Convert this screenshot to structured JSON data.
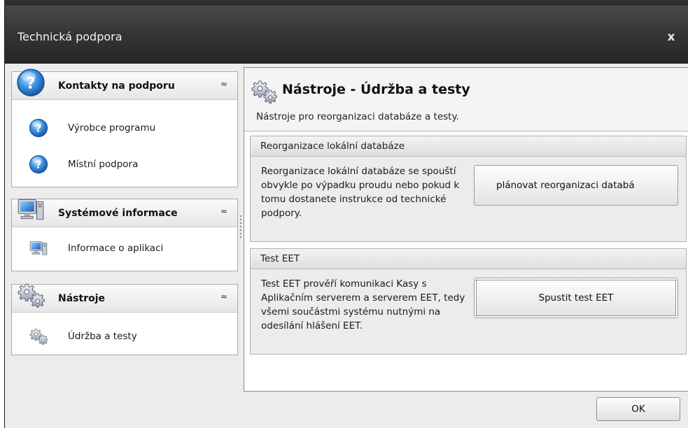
{
  "window": {
    "title": "Technická podpora",
    "close_label": "x"
  },
  "sidebar": {
    "groups": [
      {
        "label": "Kontakty na podporu",
        "icon": "help-icon",
        "items": [
          {
            "label": "Výrobce programu",
            "icon": "help-icon"
          },
          {
            "label": "Místní podpora",
            "icon": "help-icon"
          }
        ]
      },
      {
        "label": "Systémové informace",
        "icon": "computer-icon",
        "items": [
          {
            "label": "Informace o aplikaci",
            "icon": "computer-icon"
          }
        ]
      },
      {
        "label": "Nástroje",
        "icon": "gears-icon",
        "items": [
          {
            "label": "Údržba a testy",
            "icon": "gears-icon"
          }
        ]
      }
    ],
    "collapse_glyph": "≈"
  },
  "main": {
    "title": "Nástroje - Údržba a testy",
    "subtitle": "Nástroje pro reorganizaci databáze a testy.",
    "sections": [
      {
        "header": "Reorganizace lokální databáze",
        "description": "Reorganizace lokální databáze se spouští obvykle po výpadku proudu nebo pokud k tomu dostanete instrukce od technické podpory.",
        "button_label": "plánovat reorganizaci databá"
      },
      {
        "header": "Test EET",
        "description": "Test EET prověří komunikaci Kasy s Aplikačním serverem a serverem EET, tedy všemi součástmi systému nutnými na odesílání hlášení EET.",
        "button_label": "Spustit test EET"
      }
    ]
  },
  "footer": {
    "ok_label": "OK"
  },
  "colors": {
    "titlebar": "#363636",
    "help_icon_blue": "#2f7fd6",
    "panel_bg": "#ececec"
  }
}
